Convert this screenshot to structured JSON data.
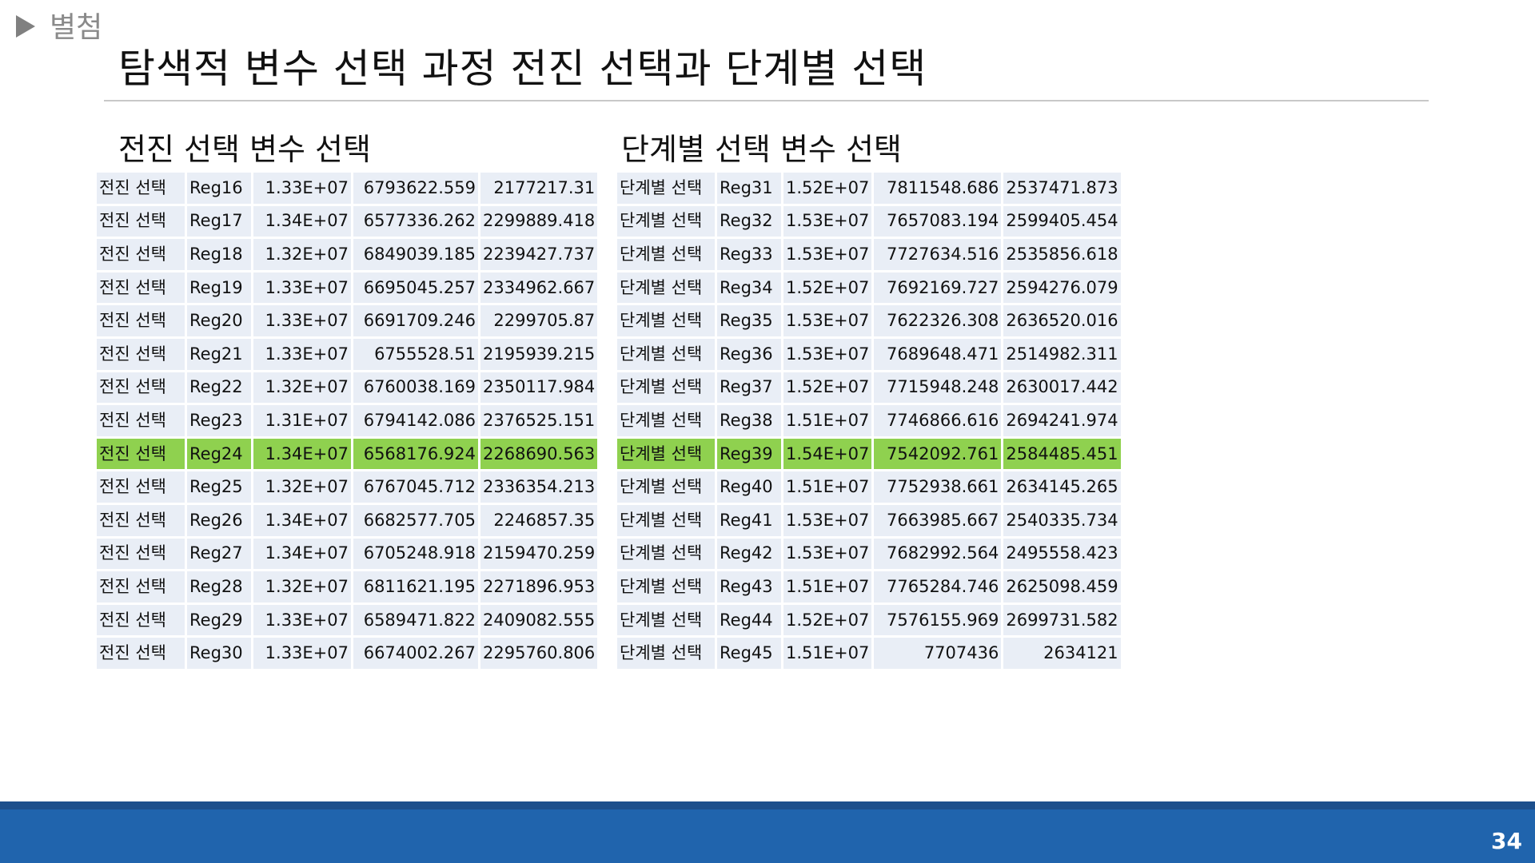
{
  "header": {
    "section_label": "별첨",
    "title": "탐색적 변수 선택 과정 전진 선택과 단계별 선택"
  },
  "forward": {
    "subtitle": "전진 선택 변수 선택",
    "rows": [
      [
        "전진 선택",
        "Reg16",
        "1.33E+07",
        "6793622.559",
        "2177217.31"
      ],
      [
        "전진 선택",
        "Reg17",
        "1.34E+07",
        "6577336.262",
        "2299889.418"
      ],
      [
        "전진 선택",
        "Reg18",
        "1.32E+07",
        "6849039.185",
        "2239427.737"
      ],
      [
        "전진 선택",
        "Reg19",
        "1.33E+07",
        "6695045.257",
        "2334962.667"
      ],
      [
        "전진 선택",
        "Reg20",
        "1.33E+07",
        "6691709.246",
        "2299705.87"
      ],
      [
        "전진 선택",
        "Reg21",
        "1.33E+07",
        "6755528.51",
        "2195939.215"
      ],
      [
        "전진 선택",
        "Reg22",
        "1.32E+07",
        "6760038.169",
        "2350117.984"
      ],
      [
        "전진 선택",
        "Reg23",
        "1.31E+07",
        "6794142.086",
        "2376525.151"
      ],
      [
        "전진 선택",
        "Reg24",
        "1.34E+07",
        "6568176.924",
        "2268690.563"
      ],
      [
        "전진 선택",
        "Reg25",
        "1.32E+07",
        "6767045.712",
        "2336354.213"
      ],
      [
        "전진 선택",
        "Reg26",
        "1.34E+07",
        "6682577.705",
        "2246857.35"
      ],
      [
        "전진 선택",
        "Reg27",
        "1.34E+07",
        "6705248.918",
        "2159470.259"
      ],
      [
        "전진 선택",
        "Reg28",
        "1.32E+07",
        "6811621.195",
        "2271896.953"
      ],
      [
        "전진 선택",
        "Reg29",
        "1.33E+07",
        "6589471.822",
        "2409082.555"
      ],
      [
        "전진 선택",
        "Reg30",
        "1.33E+07",
        "6674002.267",
        "2295760.806"
      ]
    ],
    "highlight_row": 8
  },
  "stepwise": {
    "subtitle": "단계별 선택 변수 선택",
    "rows": [
      [
        "단계별 선택",
        "Reg31",
        "1.52E+07",
        "7811548.686",
        "2537471.873"
      ],
      [
        "단계별 선택",
        "Reg32",
        "1.53E+07",
        "7657083.194",
        "2599405.454"
      ],
      [
        "단계별 선택",
        "Reg33",
        "1.53E+07",
        "7727634.516",
        "2535856.618"
      ],
      [
        "단계별 선택",
        "Reg34",
        "1.52E+07",
        "7692169.727",
        "2594276.079"
      ],
      [
        "단계별 선택",
        "Reg35",
        "1.53E+07",
        "7622326.308",
        "2636520.016"
      ],
      [
        "단계별 선택",
        "Reg36",
        "1.53E+07",
        "7689648.471",
        "2514982.311"
      ],
      [
        "단계별 선택",
        "Reg37",
        "1.52E+07",
        "7715948.248",
        "2630017.442"
      ],
      [
        "단계별 선택",
        "Reg38",
        "1.51E+07",
        "7746866.616",
        "2694241.974"
      ],
      [
        "단계별 선택",
        "Reg39",
        "1.54E+07",
        "7542092.761",
        "2584485.451"
      ],
      [
        "단계별 선택",
        "Reg40",
        "1.51E+07",
        "7752938.661",
        "2634145.265"
      ],
      [
        "단계별 선택",
        "Reg41",
        "1.53E+07",
        "7663985.667",
        "2540335.734"
      ],
      [
        "단계별 선택",
        "Reg42",
        "1.53E+07",
        "7682992.564",
        "2495558.423"
      ],
      [
        "단계별 선택",
        "Reg43",
        "1.51E+07",
        "7765284.746",
        "2625098.459"
      ],
      [
        "단계별 선택",
        "Reg44",
        "1.52E+07",
        "7576155.969",
        "2699731.582"
      ],
      [
        "단계별 선택",
        "Reg45",
        "1.51E+07",
        "7707436",
        "2634121"
      ]
    ],
    "highlight_row": 8
  },
  "colors": {
    "highlight": "#8fd14f",
    "cell": "#e9eef6",
    "footer": "#2064ad"
  },
  "footer": {
    "page_number": "34"
  }
}
